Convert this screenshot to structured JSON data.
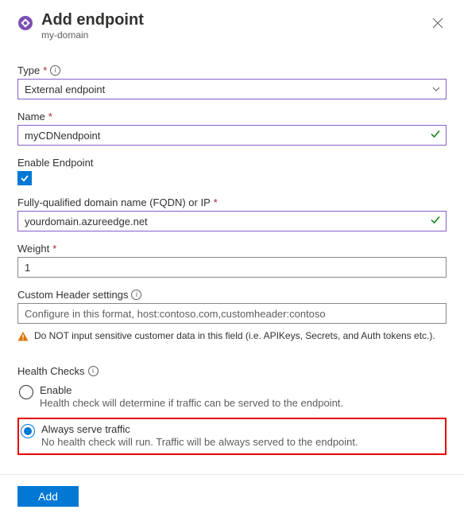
{
  "header": {
    "title": "Add endpoint",
    "subtitle": "my-domain"
  },
  "fields": {
    "type": {
      "label": "Type",
      "value": "External endpoint"
    },
    "name": {
      "label": "Name",
      "value": "myCDNendpoint"
    },
    "enable": {
      "label": "Enable Endpoint"
    },
    "fqdn": {
      "label": "Fully-qualified domain name (FQDN) or IP",
      "value": "yourdomain.azureedge.net"
    },
    "weight": {
      "label": "Weight",
      "value": "1"
    },
    "customHeader": {
      "label": "Custom Header settings",
      "placeholder": "Configure in this format, host:contoso.com,customheader:contoso"
    }
  },
  "warning": "Do NOT input sensitive customer data in this field (i.e. APIKeys, Secrets, and Auth tokens etc.).",
  "healthChecks": {
    "label": "Health Checks",
    "enable": {
      "title": "Enable",
      "desc": "Health check will determine if traffic can be served to the endpoint."
    },
    "always": {
      "title": "Always serve traffic",
      "desc": "No health check will run. Traffic will be always served to the endpoint."
    }
  },
  "footer": {
    "addLabel": "Add"
  }
}
